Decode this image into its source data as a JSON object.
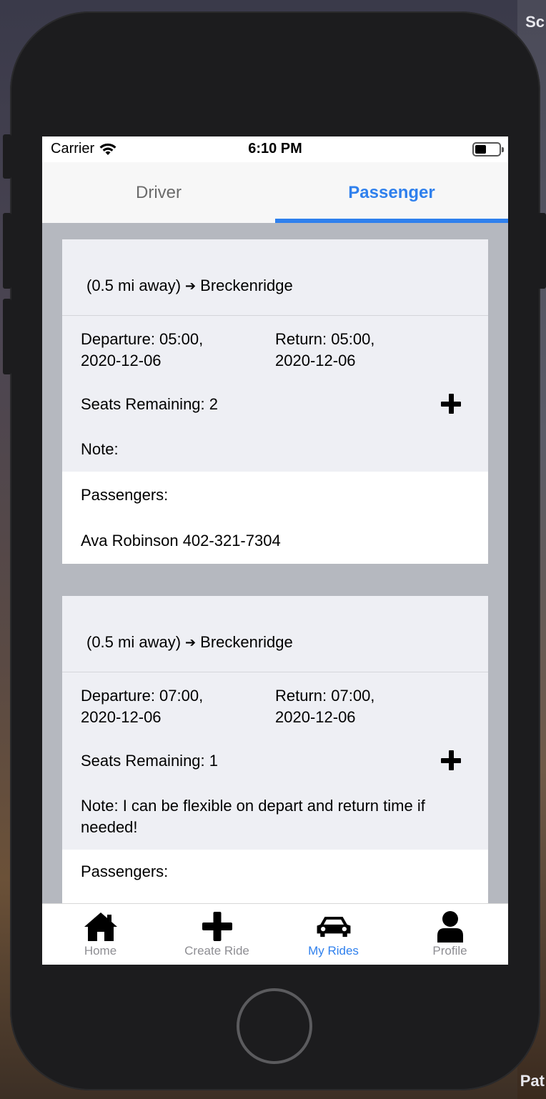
{
  "status_bar": {
    "carrier": "Carrier",
    "time": "6:10 PM"
  },
  "segmented": {
    "tabs": [
      {
        "label": "Driver",
        "active": false
      },
      {
        "label": "Passenger",
        "active": true
      }
    ]
  },
  "rides": [
    {
      "distance": "(0.5 mi away)",
      "destination": "Breckenridge",
      "departure_line1": "Departure: 05:00,",
      "departure_line2": "2020-12-06",
      "return_line1": "Return: 05:00,",
      "return_line2": "2020-12-06",
      "seats": "Seats Remaining: 2",
      "note": "Note:",
      "passengers_label": "Passengers:",
      "passengers": [
        "Ava Robinson 402-321-7304"
      ]
    },
    {
      "distance": "(0.5 mi away)",
      "destination": "Breckenridge",
      "departure_line1": "Departure: 07:00,",
      "departure_line2": "2020-12-06",
      "return_line1": "Return: 07:00,",
      "return_line2": "2020-12-06",
      "seats": "Seats Remaining: 1",
      "note": "Note: I can be flexible on depart and return time if needed!",
      "passengers_label": "Passengers:",
      "passengers": []
    }
  ],
  "tabbar": {
    "items": [
      {
        "label": "Home",
        "icon": "home-icon",
        "active": false
      },
      {
        "label": "Create Ride",
        "icon": "plus-icon",
        "active": false
      },
      {
        "label": "My Rides",
        "icon": "car-icon",
        "active": true
      },
      {
        "label": "Profile",
        "icon": "user-icon",
        "active": false
      }
    ]
  },
  "colors": {
    "accent": "#2f80ed",
    "list_background": "#b5b8bf",
    "card_background": "#eeeff4"
  }
}
